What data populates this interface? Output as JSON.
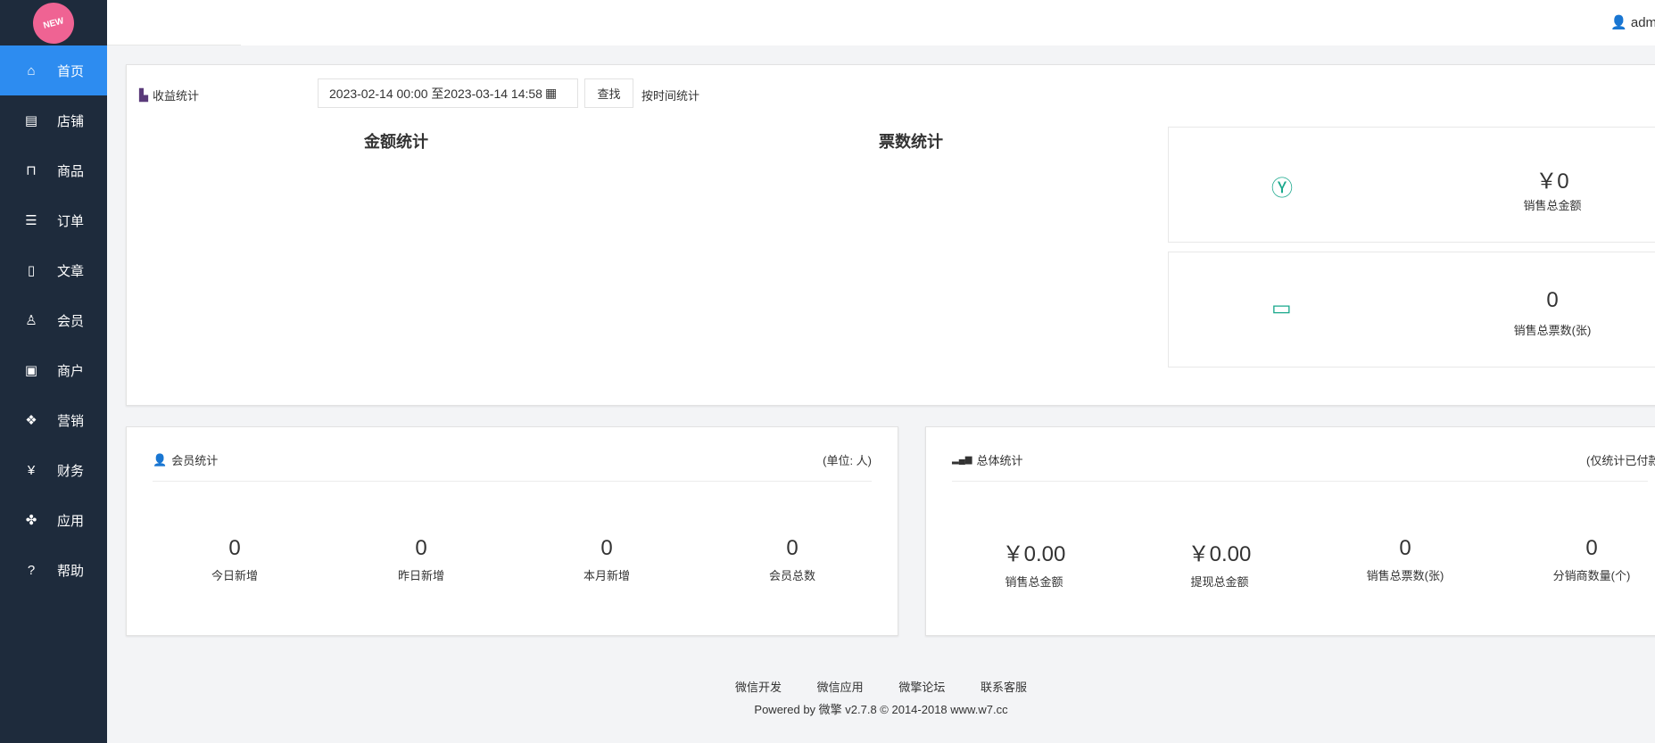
{
  "logo": {
    "text": "NEW"
  },
  "sidebar": {
    "items": [
      {
        "label": "首页",
        "icon": "home-icon"
      },
      {
        "label": "店铺",
        "icon": "store-icon"
      },
      {
        "label": "商品",
        "icon": "bag-icon"
      },
      {
        "label": "订单",
        "icon": "order-icon"
      },
      {
        "label": "文章",
        "icon": "article-icon"
      },
      {
        "label": "会员",
        "icon": "user-icon"
      },
      {
        "label": "商户",
        "icon": "merchant-icon"
      },
      {
        "label": "营销",
        "icon": "marketing-icon"
      },
      {
        "label": "财务",
        "icon": "finance-icon"
      },
      {
        "label": "应用",
        "icon": "apps-icon"
      },
      {
        "label": "帮助",
        "icon": "help-icon"
      }
    ]
  },
  "header": {
    "user": "admin"
  },
  "revenue": {
    "title": "收益统计",
    "date_range": "2023-02-14 00:00 至2023-03-14 14:58",
    "search": "查找",
    "by_time": "按时间统计",
    "amount_title": "金额统计",
    "ticket_title": "票数统计",
    "stats": [
      {
        "value": "￥0",
        "label": "销售总金额"
      },
      {
        "value": "0",
        "label": "销售总票数(张)"
      }
    ]
  },
  "members": {
    "title": "会员统计",
    "unit": "(单位: 人)",
    "cells": [
      {
        "value": "0",
        "label": "今日新增"
      },
      {
        "value": "0",
        "label": "昨日新增"
      },
      {
        "value": "0",
        "label": "本月新增"
      },
      {
        "value": "0",
        "label": "会员总数"
      }
    ]
  },
  "overall": {
    "title": "总体统计",
    "note": "(仅统计已付款",
    "cells": [
      {
        "value": "￥0.00",
        "label": "销售总金额"
      },
      {
        "value": "￥0.00",
        "label": "提现总金额"
      },
      {
        "value": "0",
        "label": "销售总票数(张)"
      },
      {
        "value": "0",
        "label": "分销商数量(个)"
      }
    ]
  },
  "footer": {
    "links": [
      "微信开发",
      "微信应用",
      "微擎论坛",
      "联系客服"
    ],
    "powered": "Powered by 微擎 v2.7.8 © 2014-2018 www.w7.cc"
  }
}
